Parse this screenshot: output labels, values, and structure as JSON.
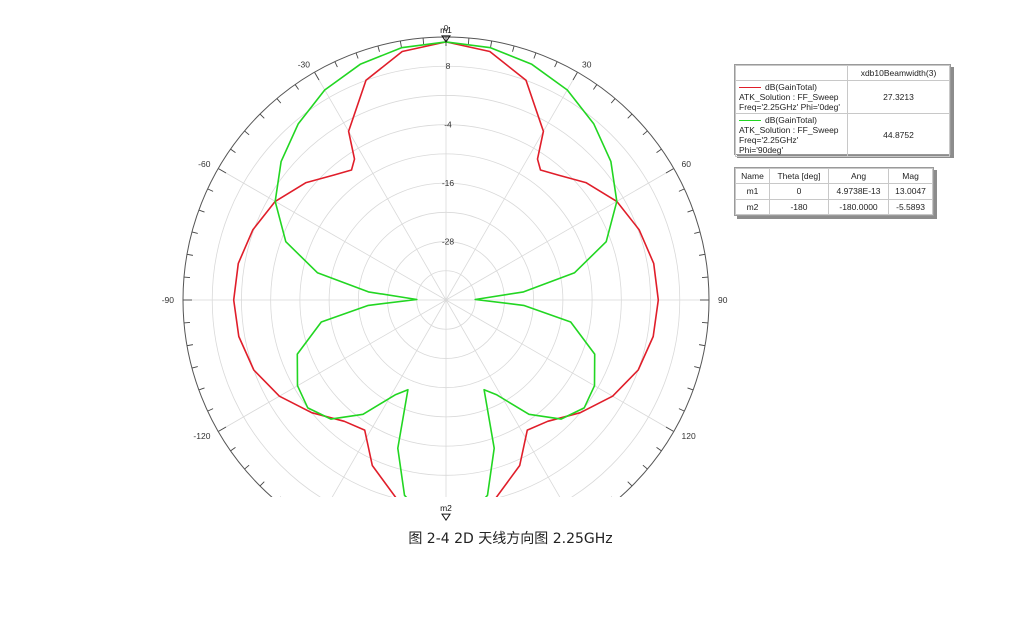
{
  "caption": "图 2-4 2D 天线方向图 2.25GHz",
  "chart_data": {
    "type": "polar",
    "theta_unit": "deg",
    "r_unit": "dB",
    "angle_labels": [
      {
        "theta": 0,
        "text": "0"
      },
      {
        "theta": 30,
        "text": "30"
      },
      {
        "theta": 60,
        "text": "60"
      },
      {
        "theta": 90,
        "text": "90"
      },
      {
        "theta": 120,
        "text": "120"
      },
      {
        "theta": -30,
        "text": "-30"
      },
      {
        "theta": -60,
        "text": "-60"
      },
      {
        "theta": -90,
        "text": "-90"
      },
      {
        "theta": -120,
        "text": "-120"
      }
    ],
    "r_range": [
      -40,
      14
    ],
    "ring_labels": [
      {
        "r": 8,
        "text": "8"
      },
      {
        "r": -4,
        "text": "-4"
      },
      {
        "r": -16,
        "text": "-16"
      },
      {
        "r": -28,
        "text": "-28"
      }
    ],
    "series": [
      {
        "name": "dB(GainTotal)",
        "description": [
          "ATK_Solution : FF_Sweep",
          "Freq='2.25GHz' Phi='0deg'"
        ],
        "color": "#e01e2a",
        "points": [
          [
            0,
            13.0
          ],
          [
            10,
            11.8
          ],
          [
            20,
            8.0
          ],
          [
            30,
            0.0
          ],
          [
            33,
            -5.5
          ],
          [
            36,
            -7.0
          ],
          [
            42,
            -5.5
          ],
          [
            50,
            -2.5
          ],
          [
            60,
            0.5
          ],
          [
            70,
            2.2
          ],
          [
            80,
            3.3
          ],
          [
            90,
            3.6
          ],
          [
            100,
            3.2
          ],
          [
            110,
            2.0
          ],
          [
            120,
            -0.5
          ],
          [
            130,
            -4.0
          ],
          [
            140,
            -7.5
          ],
          [
            148,
            -8.5
          ],
          [
            156,
            -2.8
          ],
          [
            166,
            2.0
          ],
          [
            174,
            4.3
          ],
          [
            180,
            5.2
          ],
          [
            186,
            4.3
          ],
          [
            194,
            2.0
          ],
          [
            204,
            -2.8
          ],
          [
            212,
            -8.5
          ],
          [
            220,
            -7.5
          ],
          [
            230,
            -4.0
          ],
          [
            240,
            -0.5
          ],
          [
            250,
            2.0
          ],
          [
            260,
            3.2
          ],
          [
            270,
            3.6
          ],
          [
            280,
            3.3
          ],
          [
            290,
            2.2
          ],
          [
            300,
            0.5
          ],
          [
            310,
            -2.5
          ],
          [
            318,
            -5.5
          ],
          [
            324,
            -7.0
          ],
          [
            327,
            -5.5
          ],
          [
            330,
            0.0
          ],
          [
            340,
            8.0
          ],
          [
            350,
            11.8
          ],
          [
            360,
            13.0
          ]
        ]
      },
      {
        "name": "dB(GainTotal)",
        "description": [
          "ATK_Solution : FF_Sweep",
          "Freq='2.25GHz' Phi='90deg'"
        ],
        "color": "#22d622",
        "points": [
          [
            0,
            13.0
          ],
          [
            10,
            12.6
          ],
          [
            20,
            11.5
          ],
          [
            30,
            9.8
          ],
          [
            40,
            7.2
          ],
          [
            50,
            4.2
          ],
          [
            60,
            0.5
          ],
          [
            70,
            -5.0
          ],
          [
            78,
            -13.0
          ],
          [
            84,
            -24.0
          ],
          [
            89,
            -34.0
          ],
          [
            94,
            -24.0
          ],
          [
            100,
            -14.0
          ],
          [
            110,
            -7.5
          ],
          [
            120,
            -4.8
          ],
          [
            128,
            -4.0
          ],
          [
            136,
            -6.0
          ],
          [
            144,
            -11.0
          ],
          [
            152,
            -18.0
          ],
          [
            157,
            -20.0
          ],
          [
            162,
            -8.0
          ],
          [
            168,
            1.0
          ],
          [
            174,
            4.5
          ],
          [
            180,
            5.2
          ],
          [
            186,
            4.5
          ],
          [
            192,
            1.0
          ],
          [
            198,
            -8.0
          ],
          [
            203,
            -20.0
          ],
          [
            208,
            -18.0
          ],
          [
            216,
            -11.0
          ],
          [
            224,
            -6.0
          ],
          [
            232,
            -4.0
          ],
          [
            240,
            -4.8
          ],
          [
            250,
            -7.5
          ],
          [
            260,
            -14.0
          ],
          [
            266,
            -24.0
          ],
          [
            271,
            -34.0
          ],
          [
            276,
            -24.0
          ],
          [
            282,
            -13.0
          ],
          [
            290,
            -5.0
          ],
          [
            300,
            0.5
          ],
          [
            310,
            4.2
          ],
          [
            320,
            7.2
          ],
          [
            330,
            9.8
          ],
          [
            340,
            11.5
          ],
          [
            350,
            12.6
          ],
          [
            360,
            13.0
          ]
        ]
      }
    ],
    "markers": [
      {
        "name": "m1",
        "theta": 0,
        "r": 13.0047
      },
      {
        "name": "m2",
        "theta": 180,
        "r": 5.2
      }
    ]
  },
  "legend_table": {
    "column_header": "xdb10Beamwidth(3)",
    "rows": [
      {
        "label": "dB(GainTotal)",
        "line1": "ATK_Solution : FF_Sweep",
        "line2": "Freq='2.25GHz' Phi='0deg'",
        "value": "27.3213",
        "color": "#e01e2a"
      },
      {
        "label": "dB(GainTotal)",
        "line1": "ATK_Solution : FF_Sweep",
        "line2": "Freq='2.25GHz' Phi='90deg'",
        "value": "44.8752",
        "color": "#22d622"
      }
    ]
  },
  "marker_table": {
    "headers": [
      "Name",
      "Theta [deg]",
      "Ang",
      "Mag"
    ],
    "rows": [
      [
        "m1",
        "0",
        "4.9738E-13",
        "13.0047"
      ],
      [
        "m2",
        "-180",
        "-180.0000",
        "-5.5893"
      ]
    ]
  }
}
